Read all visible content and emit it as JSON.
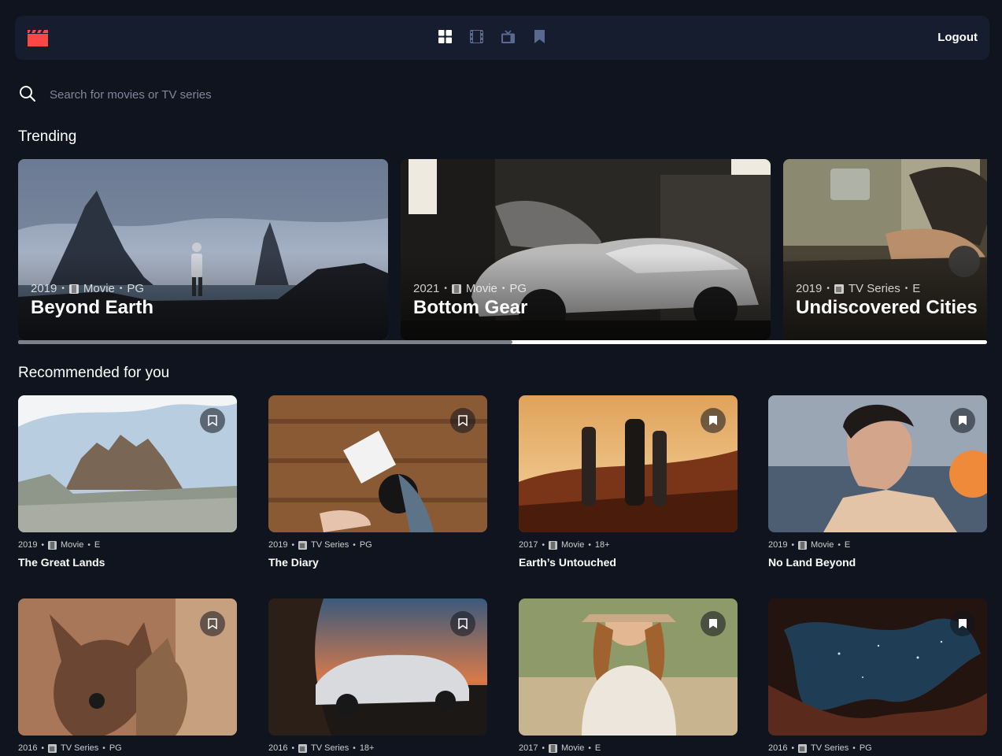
{
  "colors": {
    "background": "#10141e",
    "surface": "#161d2f",
    "accent": "#fc4747",
    "muted": "#5a698f"
  },
  "nav": {
    "logo_icon": "clapperboard-icon",
    "icons": [
      "home-grid-icon",
      "movies-icon",
      "tv-series-icon",
      "bookmark-icon"
    ],
    "active": "home-grid-icon",
    "logout_label": "Logout"
  },
  "search": {
    "placeholder": "Search for movies or TV series",
    "value": ""
  },
  "trending": {
    "title": "Trending",
    "scroll_position": 0.51,
    "items": [
      {
        "year": "2019",
        "category": "Movie",
        "rating": "PG",
        "title": "Beyond Earth"
      },
      {
        "year": "2021",
        "category": "Movie",
        "rating": "PG",
        "title": "Bottom Gear"
      },
      {
        "year": "2019",
        "category": "TV Series",
        "rating": "E",
        "title": "Undiscovered Cities"
      }
    ]
  },
  "recommended": {
    "title": "Recommended for you",
    "items": [
      {
        "year": "2019",
        "category": "Movie",
        "rating": "E",
        "title": "The Great Lands",
        "bookmarked": false
      },
      {
        "year": "2019",
        "category": "TV Series",
        "rating": "PG",
        "title": "The Diary",
        "bookmarked": false
      },
      {
        "year": "2017",
        "category": "Movie",
        "rating": "18+",
        "title": "Earth’s Untouched",
        "bookmarked": true
      },
      {
        "year": "2019",
        "category": "Movie",
        "rating": "E",
        "title": "No Land Beyond",
        "bookmarked": true
      },
      {
        "year": "2016",
        "category": "TV Series",
        "rating": "PG",
        "title": "",
        "bookmarked": false
      },
      {
        "year": "2016",
        "category": "TV Series",
        "rating": "18+",
        "title": "",
        "bookmarked": false
      },
      {
        "year": "2017",
        "category": "Movie",
        "rating": "E",
        "title": "",
        "bookmarked": true
      },
      {
        "year": "2016",
        "category": "TV Series",
        "rating": "PG",
        "title": "",
        "bookmarked": true
      }
    ]
  }
}
